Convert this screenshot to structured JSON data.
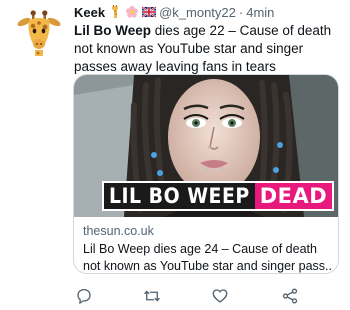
{
  "tweet": {
    "author_name": "Keek",
    "author_emojis": [
      "giraffe-emoji",
      "flower-emoji",
      "uk-flag-emoji"
    ],
    "handle": "@k_monty22",
    "separator": "·",
    "time": "4min",
    "text_bold": "Lil Bo Weep",
    "text_rest": " dies age 22 – Cause of death not known as YouTube star and singer passes away leaving fans in tears"
  },
  "card": {
    "banner_left": "LIL BO WEEP",
    "banner_right": "DEAD",
    "domain": "thesun.co.uk",
    "title_line1": "Lil Bo Weep dies age 24 – Cause of death",
    "title_line2": "not known as YouTube star and singer pass..."
  },
  "actions": {
    "icons": [
      "reply-icon",
      "retweet-icon",
      "like-icon",
      "share-icon"
    ]
  },
  "colors": {
    "text_primary": "#0f1419",
    "text_secondary": "#536471",
    "card_border": "#cfd9de",
    "banner_pink": "#e7197c"
  }
}
